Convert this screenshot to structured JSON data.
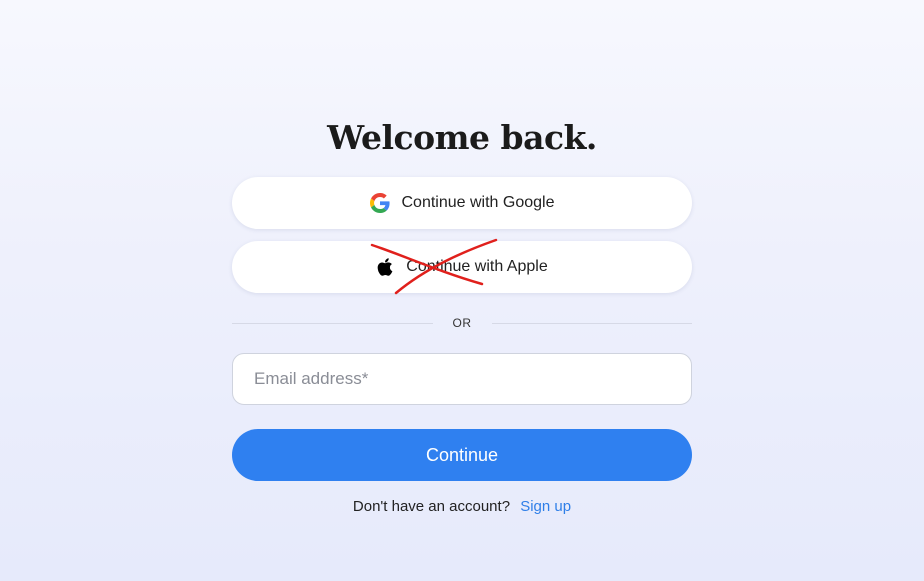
{
  "title": "Welcome back.",
  "social": {
    "google_label": "Continue with Google",
    "google_icon": "google-g-icon",
    "apple_label": "Continue with Apple",
    "apple_icon": "apple-logo-icon"
  },
  "divider_text": "OR",
  "email": {
    "placeholder": "Email address*",
    "value": ""
  },
  "continue_label": "Continue",
  "signup": {
    "prompt": "Don't have an account?",
    "link_label": "Sign up"
  },
  "colors": {
    "primary": "#2f80f0",
    "link": "#2f7fe8",
    "annotation_red": "#e0201c"
  }
}
